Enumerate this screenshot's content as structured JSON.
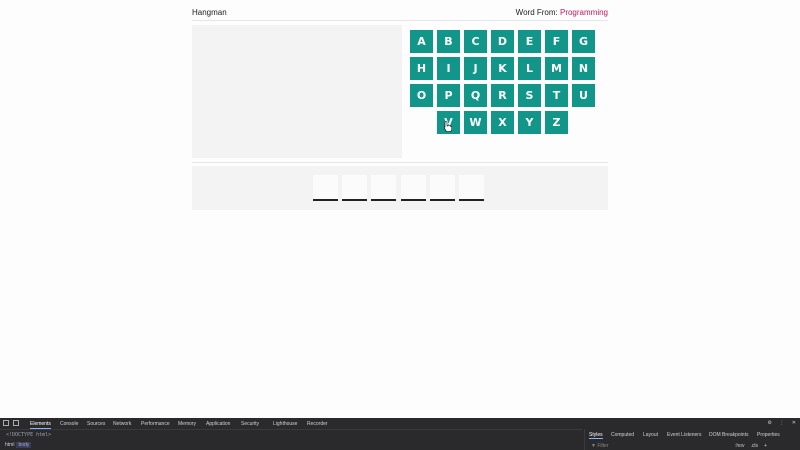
{
  "app": {
    "title": "Hangman",
    "word_from_label": "Word From:",
    "category": "Programming"
  },
  "keyboard": {
    "rows": [
      [
        "A",
        "B",
        "C",
        "D",
        "E",
        "F",
        "G"
      ],
      [
        "H",
        "I",
        "J",
        "K",
        "L",
        "M",
        "N"
      ],
      [
        "O",
        "P",
        "Q",
        "R",
        "S",
        "T",
        "U"
      ],
      [
        "V",
        "W",
        "X",
        "Y",
        "Z"
      ]
    ]
  },
  "word": {
    "slot_count": 6
  },
  "devtools": {
    "tabs": [
      "Elements",
      "Console",
      "Sources",
      "Network",
      "Performance",
      "Memory",
      "Application",
      "Security",
      "Lighthouse",
      "Recorder"
    ],
    "active_tab": "Elements",
    "code_line": "<!DOCTYPE html>",
    "breadcrumbs": [
      "html",
      "body"
    ],
    "selected_crumb": "body",
    "right_tabs": [
      "Styles",
      "Computed",
      "Layout",
      "Event Listeners",
      "DOM Breakpoints",
      "Properties"
    ],
    "active_right_tab": "Styles",
    "filter_placeholder": "Filter",
    "filter_hints": [
      ":hov",
      ".cls",
      "+"
    ]
  }
}
